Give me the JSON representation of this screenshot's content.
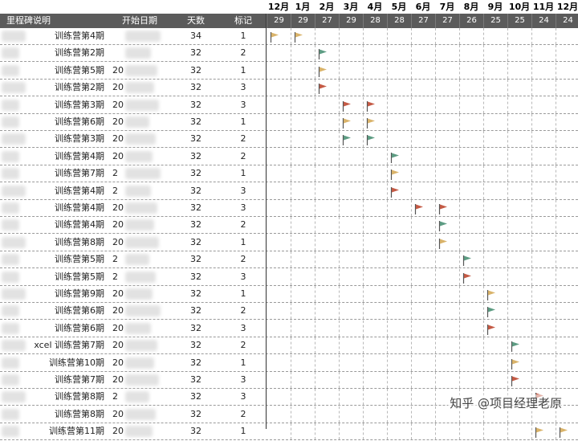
{
  "months": [
    "12月",
    "1月",
    "2月",
    "3月",
    "4月",
    "5月",
    "6月",
    "7月",
    "8月",
    "9月",
    "10月",
    "11月",
    "12月"
  ],
  "days": [
    "29",
    "29",
    "27",
    "29",
    "28",
    "28",
    "27",
    "27",
    "26",
    "25",
    "25",
    "24",
    "24"
  ],
  "headers": {
    "name": "里程碑说明",
    "start": "开始日期",
    "days": "天数",
    "mark": "标记"
  },
  "watermark": "知乎 @项目经理老原",
  "colors": {
    "tan": "#d9b36a",
    "green": "#5d9c83",
    "red": "#c45a45",
    "header": "#5b5b5b"
  },
  "rows": [
    {
      "name": "训练营第4期",
      "date": "",
      "days": "34",
      "mark": "1",
      "flags": [
        {
          "col": 0,
          "color": "tan"
        },
        {
          "col": 1,
          "color": "tan"
        }
      ]
    },
    {
      "name": "训练营第2期",
      "date": "",
      "days": "32",
      "mark": "2",
      "flags": [
        {
          "col": 2,
          "color": "green"
        }
      ]
    },
    {
      "name": "训练营第5期",
      "date": "20",
      "days": "32",
      "mark": "1",
      "flags": [
        {
          "col": 2,
          "color": "tan"
        }
      ]
    },
    {
      "name": "训练营第2期",
      "date": "20",
      "days": "32",
      "mark": "3",
      "flags": [
        {
          "col": 2,
          "color": "red"
        }
      ]
    },
    {
      "name": "训练营第3期",
      "date": "20",
      "days": "32",
      "mark": "3",
      "flags": [
        {
          "col": 3,
          "color": "red"
        },
        {
          "col": 4,
          "color": "red"
        }
      ]
    },
    {
      "name": "训练营第6期",
      "date": "20",
      "days": "32",
      "mark": "1",
      "flags": [
        {
          "col": 3,
          "color": "tan"
        },
        {
          "col": 4,
          "color": "tan"
        }
      ]
    },
    {
      "name": "训练营第3期",
      "date": "20",
      "days": "32",
      "mark": "2",
      "flags": [
        {
          "col": 3,
          "color": "green"
        },
        {
          "col": 4,
          "color": "green"
        }
      ]
    },
    {
      "name": "训练营第4期",
      "date": "20",
      "days": "32",
      "mark": "2",
      "flags": [
        {
          "col": 5,
          "color": "green"
        }
      ]
    },
    {
      "name": "训练营第7期",
      "date": "2",
      "days": "32",
      "mark": "1",
      "flags": [
        {
          "col": 5,
          "color": "tan"
        }
      ]
    },
    {
      "name": "训练营第4期",
      "date": "2",
      "days": "32",
      "mark": "3",
      "flags": [
        {
          "col": 5,
          "color": "red"
        }
      ]
    },
    {
      "name": "训练营第4期",
      "date": "20",
      "days": "32",
      "mark": "3",
      "flags": [
        {
          "col": 6,
          "color": "red"
        },
        {
          "col": 7,
          "color": "red"
        }
      ]
    },
    {
      "name": "训练营第4期",
      "date": "20",
      "days": "32",
      "mark": "2",
      "flags": [
        {
          "col": 7,
          "color": "green"
        }
      ]
    },
    {
      "name": "训练营第8期",
      "date": "20",
      "days": "32",
      "mark": "1",
      "flags": [
        {
          "col": 7,
          "color": "tan"
        }
      ]
    },
    {
      "name": "训练营第5期",
      "date": "2",
      "days": "32",
      "mark": "2",
      "flags": [
        {
          "col": 8,
          "color": "green"
        }
      ]
    },
    {
      "name": "训练营第5期",
      "date": "2",
      "days": "32",
      "mark": "3",
      "flags": [
        {
          "col": 8,
          "color": "red"
        }
      ]
    },
    {
      "name": "训练营第9期",
      "date": "20",
      "days": "32",
      "mark": "1",
      "flags": [
        {
          "col": 9,
          "color": "tan"
        }
      ]
    },
    {
      "name": "训练营第6期",
      "date": "20",
      "days": "32",
      "mark": "2",
      "flags": [
        {
          "col": 9,
          "color": "green"
        }
      ]
    },
    {
      "name": "训练营第6期",
      "date": "20",
      "days": "32",
      "mark": "3",
      "flags": [
        {
          "col": 9,
          "color": "red"
        }
      ]
    },
    {
      "name": "xcel 训练营第7期",
      "date": "20",
      "days": "32",
      "mark": "2",
      "flags": [
        {
          "col": 10,
          "color": "green"
        }
      ]
    },
    {
      "name": "训练营第10期",
      "date": "20",
      "days": "32",
      "mark": "1",
      "flags": [
        {
          "col": 10,
          "color": "tan"
        }
      ]
    },
    {
      "name": "训练营第7期",
      "date": "20",
      "days": "32",
      "mark": "3",
      "flags": [
        {
          "col": 10,
          "color": "red"
        }
      ]
    },
    {
      "name": "训练营第8期",
      "date": "2",
      "days": "32",
      "mark": "3",
      "flags": [
        {
          "col": 11,
          "color": "red"
        }
      ]
    },
    {
      "name": "训练营第8期",
      "date": "20",
      "days": "32",
      "mark": "2",
      "flags": []
    },
    {
      "name": "训练营第11期",
      "date": "20",
      "days": "32",
      "mark": "1",
      "flags": [
        {
          "col": 11,
          "color": "tan"
        },
        {
          "col": 12,
          "color": "tan"
        }
      ]
    }
  ]
}
